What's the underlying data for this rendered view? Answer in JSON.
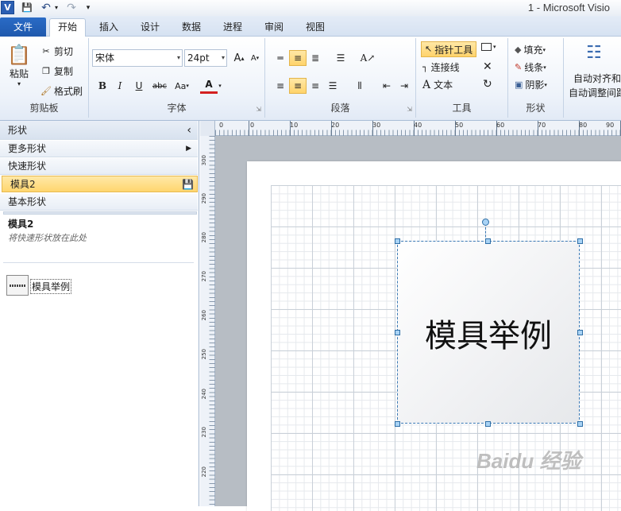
{
  "window": {
    "title": "1  -  Microsoft Visio"
  },
  "quick_access": {
    "app_icon": "visio-logo-icon",
    "items": [
      "save-icon",
      "undo-icon",
      "redo-icon",
      "customize-icon"
    ]
  },
  "tabs": [
    {
      "label": "文件"
    },
    {
      "label": "开始"
    },
    {
      "label": "插入"
    },
    {
      "label": "设计"
    },
    {
      "label": "数据"
    },
    {
      "label": "进程"
    },
    {
      "label": "审阅"
    },
    {
      "label": "视图"
    }
  ],
  "ribbon": {
    "clipboard": {
      "label": "剪贴板",
      "paste": "粘贴",
      "cut": "剪切",
      "copy": "复制",
      "format_painter": "格式刷"
    },
    "font": {
      "label": "字体",
      "family": "宋体",
      "size": "24pt",
      "bold": "B",
      "italic": "I",
      "underline": "U",
      "strike": "abc",
      "case": "Aa",
      "color": "A"
    },
    "paragraph": {
      "label": "段落"
    },
    "tools": {
      "label": "工具",
      "pointer": "指针工具",
      "connector": "连接线",
      "text": "文本"
    },
    "shape": {
      "label": "形状",
      "fill": "填充",
      "line": "线条",
      "shadow": "阴影"
    },
    "arrange": {
      "auto_align": "自动对齐和",
      "auto_adjust": "自动调整间距"
    }
  },
  "shapes_panel": {
    "header": "形状",
    "more_shapes": "更多形状",
    "quick_shapes": "快速形状",
    "active_stencil": "模具2",
    "basic_shapes": "基本形状",
    "stencil_title": "模具2",
    "stencil_hint": "将快速形状放在此处",
    "master_label": "模具举例"
  },
  "rulers": {
    "top_ticks": [
      "0",
      "0",
      "10",
      "20",
      "30",
      "40",
      "50",
      "60",
      "70",
      "80",
      "90"
    ],
    "left_ticks": [
      "300",
      "290",
      "280",
      "270",
      "260",
      "250",
      "240",
      "230",
      "220"
    ]
  },
  "canvas": {
    "shape_text": "模具举例"
  },
  "watermark": "Baidu 经验"
}
